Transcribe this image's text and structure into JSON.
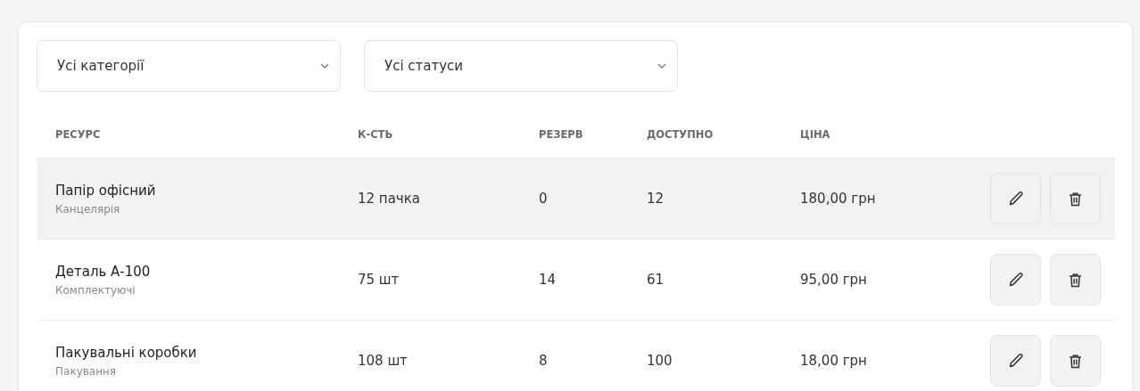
{
  "filters": [
    {
      "value": "Усі категорії"
    },
    {
      "value": "Усі статуси"
    }
  ],
  "table": {
    "columns": [
      "РЕСУРС",
      "К-СТЬ",
      "РЕЗЕРВ",
      "ДОСТУПНО",
      "ЦІНА"
    ],
    "rows": [
      {
        "name": "Папір офісний",
        "category": "Канцелярія",
        "quantity": "12 пачка",
        "reserve": "0",
        "available": "12",
        "price": "180,00 грн",
        "highlighted": true
      },
      {
        "name": "Деталь А-100",
        "category": "Комплектуючі",
        "quantity": "75 шт",
        "reserve": "14",
        "available": "61",
        "price": "95,00 грн",
        "highlighted": false
      },
      {
        "name": "Пакувальні коробки",
        "category": "Пакування",
        "quantity": "108 шт",
        "reserve": "8",
        "available": "100",
        "price": "18,00 грн",
        "highlighted": false
      }
    ]
  }
}
